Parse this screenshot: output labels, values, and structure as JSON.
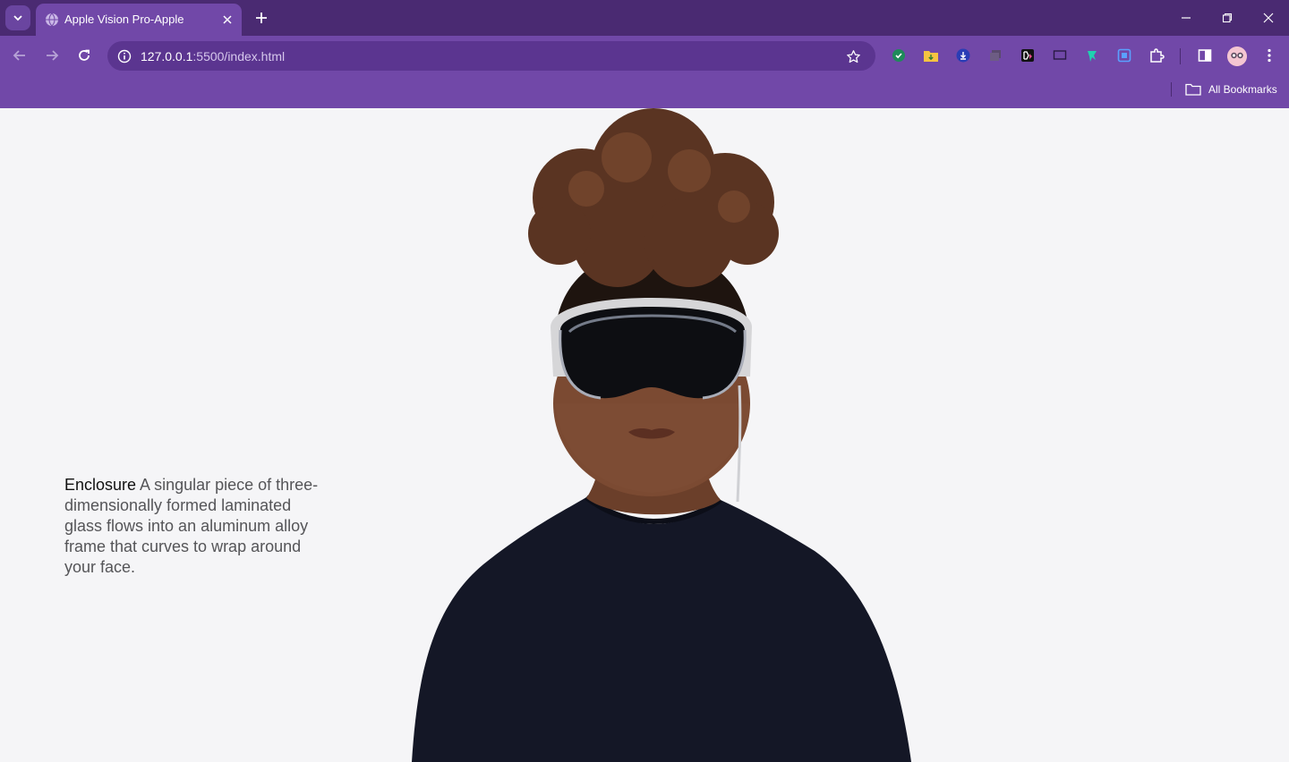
{
  "browser": {
    "tab_title": "Apple Vision Pro-Apple",
    "url_host": "127.0.0.1",
    "url_path": ":5500/index.html",
    "bookmarks_label": "All Bookmarks",
    "accent": "#7148a8",
    "tabstrip_color": "#4a2a72"
  },
  "page": {
    "feature_name": "Enclosure",
    "feature_text": " A singular piece of three-dimensionally formed laminated glass flows into an aluminum alloy frame that curves to wrap around your face.",
    "background": "#f5f5f7"
  },
  "icons": {
    "extensions": [
      "shield-check-icon",
      "folder-download-icon",
      "download-icon",
      "tabs-icon",
      "media-icon",
      "screen-icon",
      "pin-icon",
      "screenshot-icon",
      "puzzle-icon"
    ]
  }
}
